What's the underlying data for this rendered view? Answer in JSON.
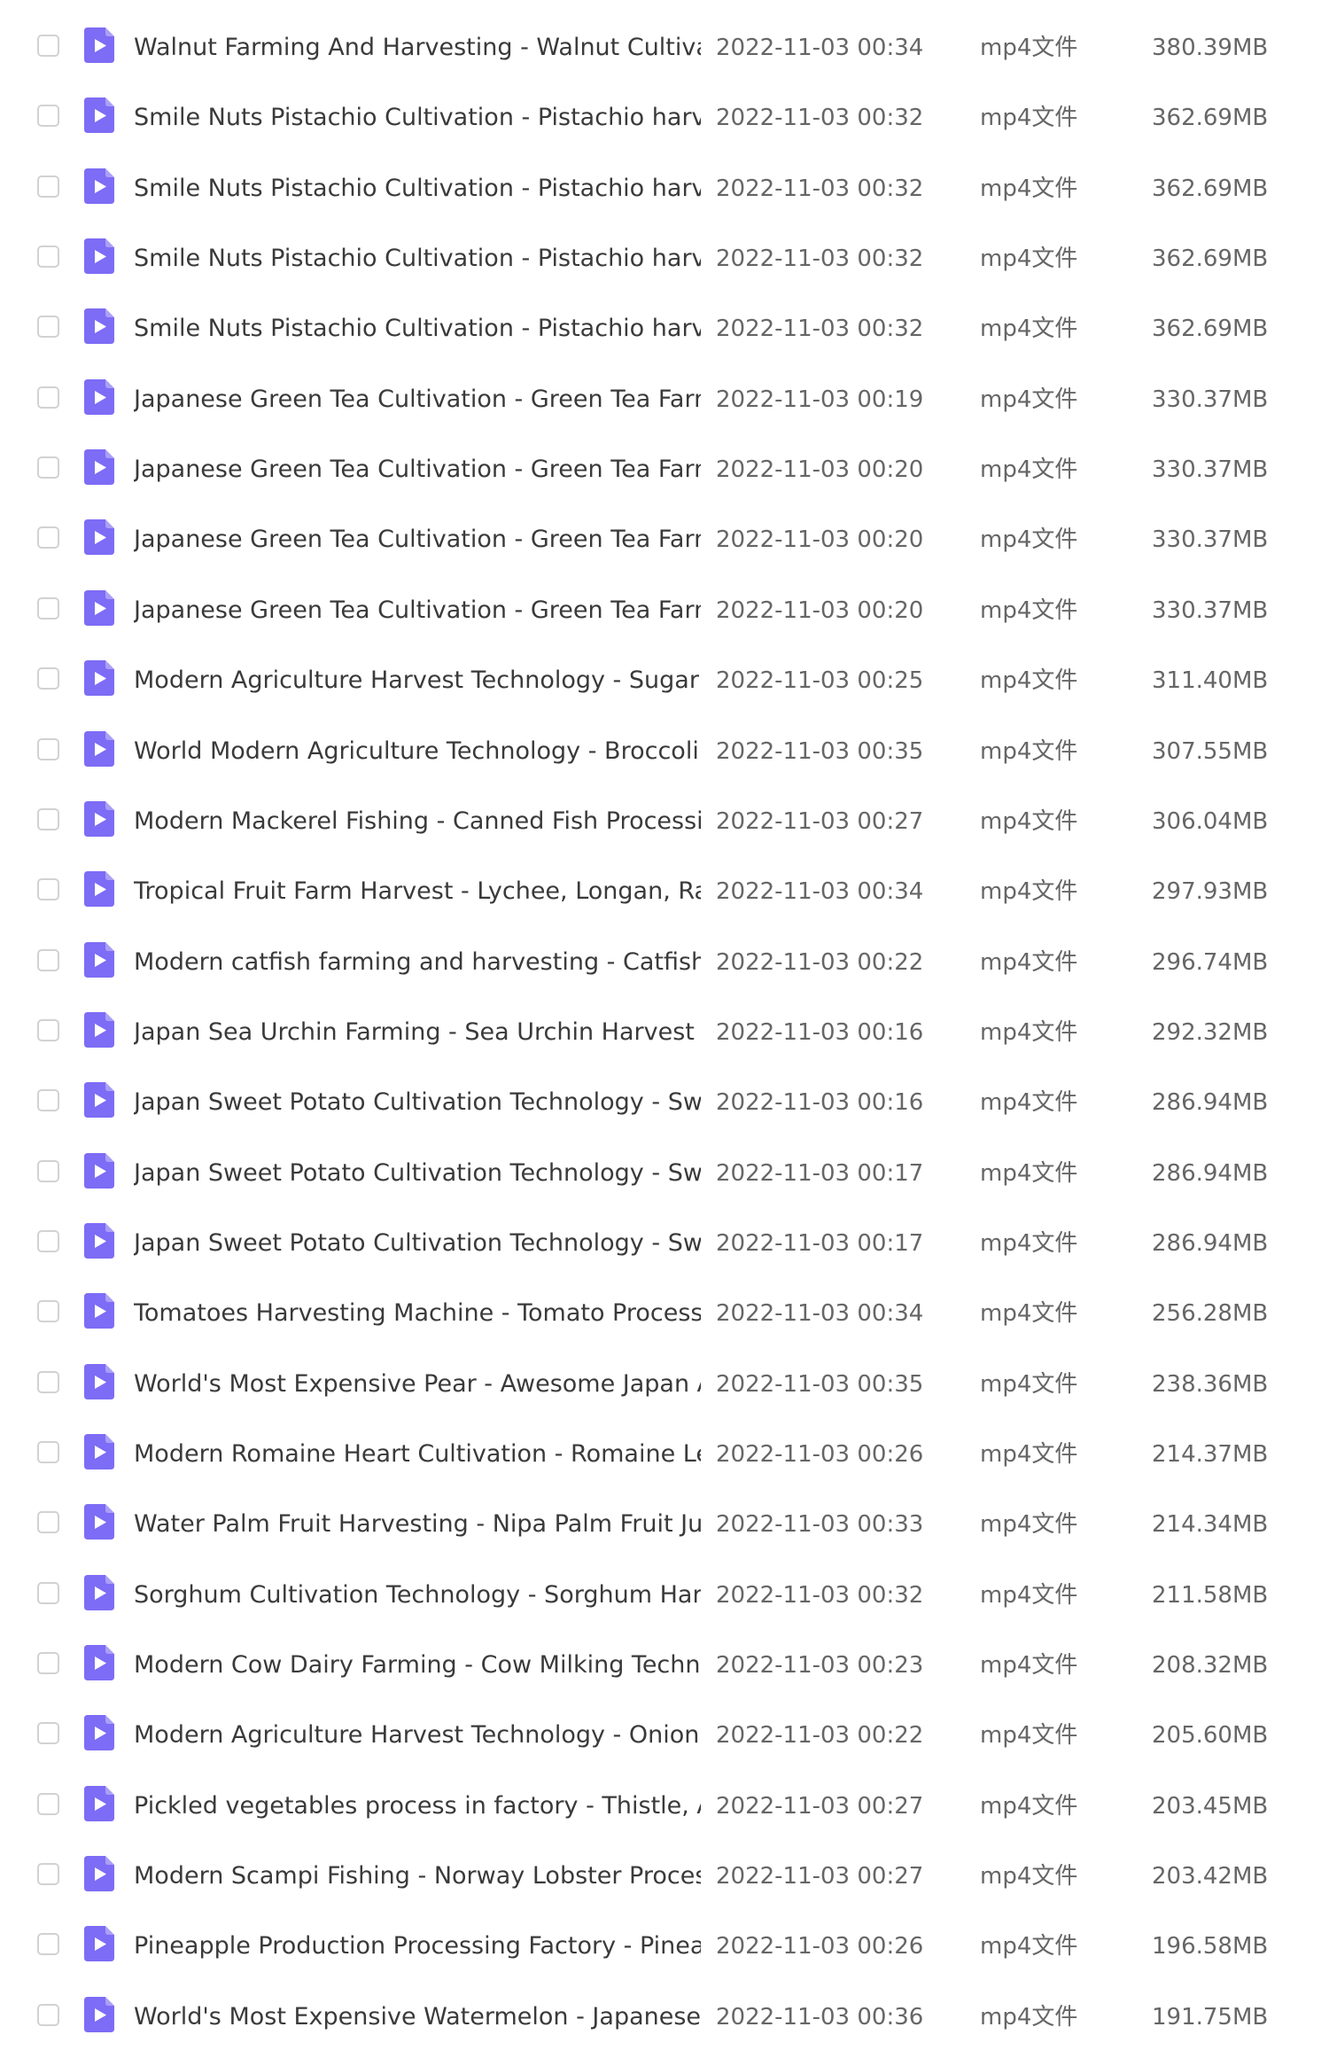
{
  "colors": {
    "icon_accent": "#7d6cf5",
    "checkbox_border": "#d2d2d2"
  },
  "icon": "video-file-icon",
  "files": [
    {
      "name": "Walnut Farming And Harvesting - Walnut Cultivatio...",
      "date": "2022-11-03 00:34",
      "type": "mp4文件",
      "size": "380.39MB"
    },
    {
      "name": "Smile Nuts Pistachio Cultivation - Pistachio harvest ...",
      "date": "2022-11-03 00:32",
      "type": "mp4文件",
      "size": "362.69MB"
    },
    {
      "name": "Smile Nuts Pistachio Cultivation - Pistachio harvest ...",
      "date": "2022-11-03 00:32",
      "type": "mp4文件",
      "size": "362.69MB"
    },
    {
      "name": "Smile Nuts Pistachio Cultivation - Pistachio harvest ...",
      "date": "2022-11-03 00:32",
      "type": "mp4文件",
      "size": "362.69MB"
    },
    {
      "name": "Smile Nuts Pistachio Cultivation - Pistachio harvest ...",
      "date": "2022-11-03 00:32",
      "type": "mp4文件",
      "size": "362.69MB"
    },
    {
      "name": "Japanese Green Tea Cultivation - Green Tea Farm - ...",
      "date": "2022-11-03 00:19",
      "type": "mp4文件",
      "size": "330.37MB"
    },
    {
      "name": "Japanese Green Tea Cultivation - Green Tea Farm - ...",
      "date": "2022-11-03 00:20",
      "type": "mp4文件",
      "size": "330.37MB"
    },
    {
      "name": "Japanese Green Tea Cultivation - Green Tea Farm - ...",
      "date": "2022-11-03 00:20",
      "type": "mp4文件",
      "size": "330.37MB"
    },
    {
      "name": "Japanese Green Tea Cultivation - Green Tea Farm - ...",
      "date": "2022-11-03 00:20",
      "type": "mp4文件",
      "size": "330.37MB"
    },
    {
      "name": "Modern Agriculture Harvest Technology - Sugar be...",
      "date": "2022-11-03 00:25",
      "type": "mp4文件",
      "size": "311.40MB"
    },
    {
      "name": "World Modern Agriculture Technology - Broccoli, C...",
      "date": "2022-11-03 00:35",
      "type": "mp4文件",
      "size": "307.55MB"
    },
    {
      "name": "Modern Mackerel Fishing - Canned Fish Processing ...",
      "date": "2022-11-03 00:27",
      "type": "mp4文件",
      "size": "306.04MB"
    },
    {
      "name": "Tropical Fruit Farm Harvest - Lychee, Longan, Ramb...",
      "date": "2022-11-03 00:34",
      "type": "mp4文件",
      "size": "297.93MB"
    },
    {
      "name": "Modern catfish farming and harvesting - Catfish Pr...",
      "date": "2022-11-03 00:22",
      "type": "mp4文件",
      "size": "296.74MB"
    },
    {
      "name": "Japan Sea Urchin Farming - Sea Urchin Harvest and...",
      "date": "2022-11-03 00:16",
      "type": "mp4文件",
      "size": "292.32MB"
    },
    {
      "name": "Japan Sweet Potato Cultivation Technology - Sweet...",
      "date": "2022-11-03 00:16",
      "type": "mp4文件",
      "size": "286.94MB"
    },
    {
      "name": "Japan Sweet Potato Cultivation Technology - Sweet...",
      "date": "2022-11-03 00:17",
      "type": "mp4文件",
      "size": "286.94MB"
    },
    {
      "name": "Japan Sweet Potato Cultivation Technology - Sweet...",
      "date": "2022-11-03 00:17",
      "type": "mp4文件",
      "size": "286.94MB"
    },
    {
      "name": "Tomatoes Harvesting Machine - Tomato Processin...",
      "date": "2022-11-03 00:34",
      "type": "mp4文件",
      "size": "256.28MB"
    },
    {
      "name": "World's Most Expensive Pear - Awesome Japan Agr...",
      "date": "2022-11-03 00:35",
      "type": "mp4文件",
      "size": "238.36MB"
    },
    {
      "name": "Modern Romaine Heart Cultivation - Romaine Lettu...",
      "date": "2022-11-03 00:26",
      "type": "mp4文件",
      "size": "214.37MB"
    },
    {
      "name": "Water Palm Fruit Harvesting - Nipa Palm Fruit Juice ...",
      "date": "2022-11-03 00:33",
      "type": "mp4文件",
      "size": "214.34MB"
    },
    {
      "name": "Sorghum Cultivation Technology - Sorghum Harves...",
      "date": "2022-11-03 00:32",
      "type": "mp4文件",
      "size": "211.58MB"
    },
    {
      "name": "Modern Cow Dairy Farming - Cow Milking Technol...",
      "date": "2022-11-03 00:23",
      "type": "mp4文件",
      "size": "208.32MB"
    },
    {
      "name": "Modern Agriculture Harvest Technology - Onion Se...",
      "date": "2022-11-03 00:22",
      "type": "mp4文件",
      "size": "205.60MB"
    },
    {
      "name": "Pickled vegetables process in factory - Thistle, Asp...",
      "date": "2022-11-03 00:27",
      "type": "mp4文件",
      "size": "203.45MB"
    },
    {
      "name": "Modern Scampi Fishing - Norway Lobster Processin...",
      "date": "2022-11-03 00:27",
      "type": "mp4文件",
      "size": "203.42MB"
    },
    {
      "name": "Pineapple Production Processing Factory - Pineappl...",
      "date": "2022-11-03 00:26",
      "type": "mp4文件",
      "size": "196.58MB"
    },
    {
      "name": "World's Most Expensive Watermelon - Japanese Bl...",
      "date": "2022-11-03 00:36",
      "type": "mp4文件",
      "size": "191.75MB"
    }
  ]
}
